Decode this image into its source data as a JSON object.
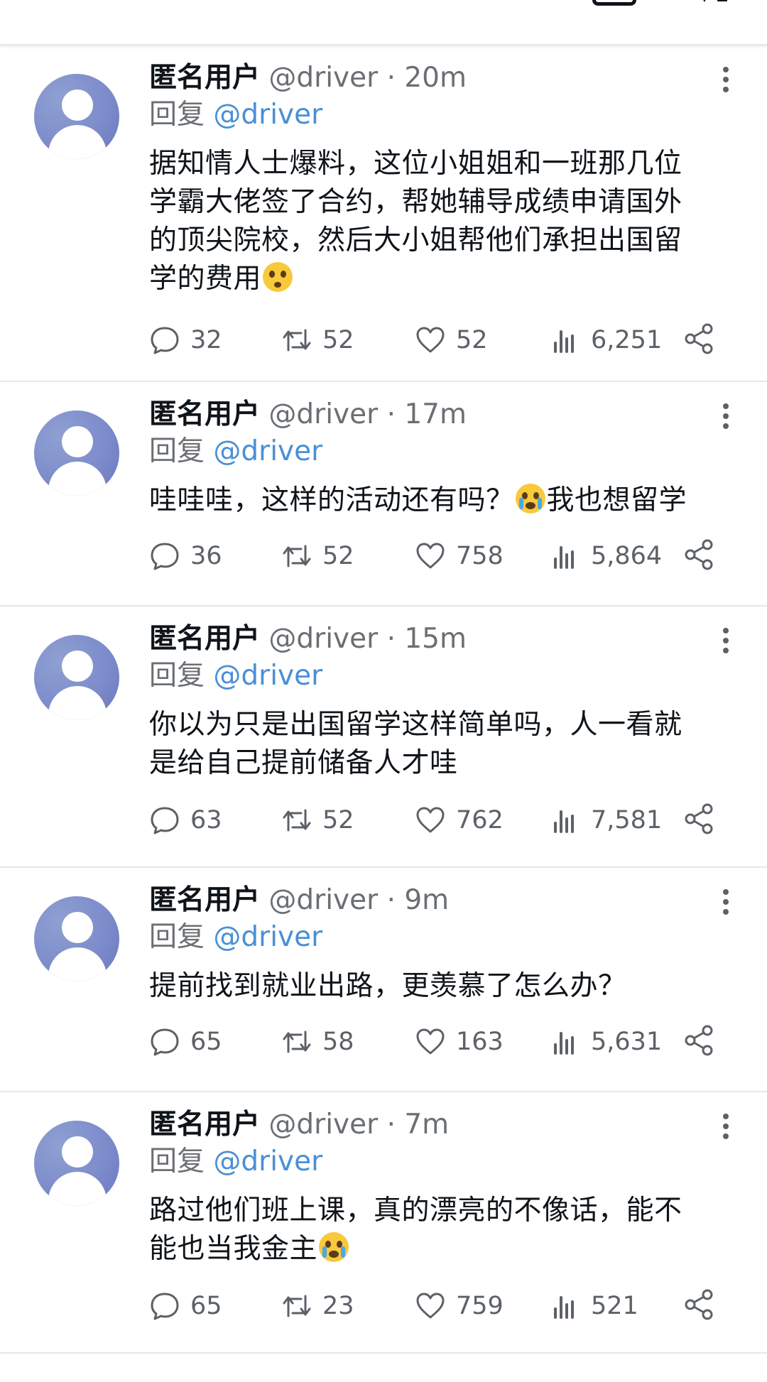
{
  "posts": [
    {
      "name": "匿名用户",
      "handle": "@driver",
      "time": "20m",
      "reply_prefix": "回复",
      "reply_to": "@driver",
      "text_lines": [
        "据知情人士爆料，这位小姐姐和一班那几位",
        "学霸大佬签了合约，帮她辅导成绩申请国外",
        "的顶尖院校，然后大小姐帮他们承担出国留",
        "学的费用"
      ],
      "emoji": "flushed-face",
      "replies": "32",
      "retweets": "52",
      "likes": "52",
      "views": "6,251"
    },
    {
      "name": "匿名用户",
      "handle": "@driver",
      "time": "17m",
      "reply_prefix": "回复",
      "reply_to": "@driver",
      "text_a": "哇哇哇，这样的活动还有吗？",
      "text_b": "我也想留学",
      "emoji": "crying-face",
      "replies": "36",
      "retweets": "52",
      "likes": "758",
      "views": "5,864"
    },
    {
      "name": "匿名用户",
      "handle": "@driver",
      "time": "15m",
      "reply_prefix": "回复",
      "reply_to": "@driver",
      "text_lines": [
        "你以为只是出国留学这样简单吗，人一看就",
        "是给自己提前储备人才哇"
      ],
      "replies": "63",
      "retweets": "52",
      "likes": "762",
      "views": "7,581"
    },
    {
      "name": "匿名用户",
      "handle": "@driver",
      "time": "9m",
      "reply_prefix": "回复",
      "reply_to": "@driver",
      "text_lines": [
        "提前找到就业出路，更羡慕了怎么办？"
      ],
      "replies": "65",
      "retweets": "58",
      "likes": "163",
      "views": "5,631"
    },
    {
      "name": "匿名用户",
      "handle": "@driver",
      "time": "7m",
      "reply_prefix": "回复",
      "reply_to": "@driver",
      "text_lines": [
        "路过他们班上课，真的漂亮的不像话，能不",
        "能也当我金主"
      ],
      "emoji": "crying-face",
      "replies": "65",
      "retweets": "23",
      "likes": "759",
      "views": "521"
    }
  ],
  "colors": {
    "mention": "#4a8fd6",
    "muted": "#6b6f74",
    "avatar": "#7d8ccb"
  }
}
